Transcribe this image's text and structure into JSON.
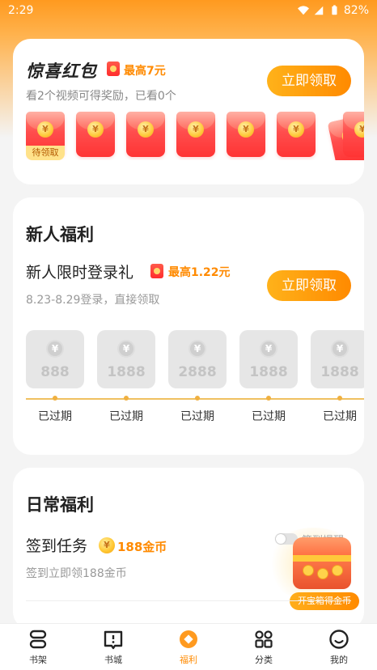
{
  "status": {
    "time": "2:29",
    "battery": "82%"
  },
  "promo": {
    "title": "惊喜红包",
    "max_label": "最高7元",
    "subtitle": "看2个视频可得奖励，已看0个",
    "button": "立即领取",
    "coin_symbol": "¥",
    "first_tag": "待领取"
  },
  "newbie": {
    "section_title": "新人福利",
    "row_title": "新人限时登录礼",
    "max_label": "最高1.22元",
    "subtitle": "8.23-8.29登录，直接领取",
    "button": "立即领取",
    "coin_symbol": "¥",
    "days": [
      {
        "amount": "888",
        "status": "已过期"
      },
      {
        "amount": "1888",
        "status": "已过期"
      },
      {
        "amount": "2888",
        "status": "已过期"
      },
      {
        "amount": "1888",
        "status": "已过期"
      },
      {
        "amount": "1888",
        "status": "已过期"
      }
    ]
  },
  "daily": {
    "section_title": "日常福利",
    "checkin_title": "签到任务",
    "checkin_reward": "188金币",
    "checkin_sub": "签到立即领188金币",
    "remind_label": "签到提醒",
    "chest_label": "开宝箱得金币",
    "coin_symbol": "¥"
  },
  "nav": [
    {
      "label": "书架",
      "icon": "bookshelf-icon"
    },
    {
      "label": "书城",
      "icon": "bookstore-icon"
    },
    {
      "label": "福利",
      "icon": "welfare-icon"
    },
    {
      "label": "分类",
      "icon": "category-icon"
    },
    {
      "label": "我的",
      "icon": "profile-icon"
    }
  ],
  "colors": {
    "accent": "#ff8a00",
    "header": "#ff9a1f",
    "red": "#ff3434"
  }
}
